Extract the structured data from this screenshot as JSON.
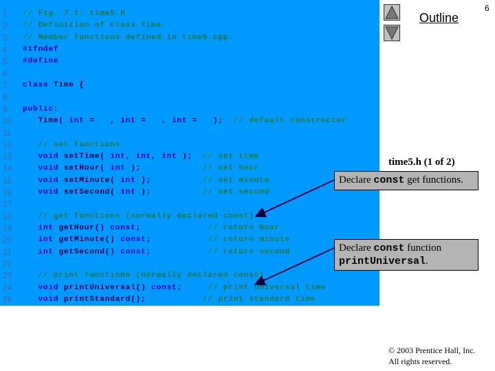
{
  "code_lines": [
    {
      "n": "1",
      "t": [
        [
          "c",
          "// Fig. 7.1: time5.h"
        ]
      ]
    },
    {
      "n": "2",
      "t": [
        [
          "c",
          "// Definition of class Time."
        ]
      ]
    },
    {
      "n": "3",
      "t": [
        [
          "c",
          "// Member functions defined in time5.cpp."
        ]
      ]
    },
    {
      "n": "4",
      "t": [
        [
          "p",
          "#ifndef"
        ]
      ]
    },
    {
      "n": "5",
      "t": [
        [
          "p",
          "#define"
        ]
      ]
    },
    {
      "n": "6",
      "t": []
    },
    {
      "n": "7",
      "t": [
        [
          "k",
          "class "
        ],
        [
          "i",
          "Time {"
        ]
      ]
    },
    {
      "n": "8",
      "t": []
    },
    {
      "n": "9",
      "t": [
        [
          "k",
          "public:"
        ]
      ]
    },
    {
      "n": "10",
      "t": [
        [
          "i",
          "   Time( "
        ],
        [
          "k",
          "int"
        ],
        [
          "i",
          " =   , "
        ],
        [
          "k",
          "int"
        ],
        [
          "i",
          " =   , "
        ],
        [
          "k",
          "int"
        ],
        [
          "i",
          " =   );  "
        ],
        [
          "c",
          "// default constructor"
        ]
      ]
    },
    {
      "n": "11",
      "t": []
    },
    {
      "n": "12",
      "t": [
        [
          "c",
          "   // set functions"
        ]
      ]
    },
    {
      "n": "13",
      "t": [
        [
          "k",
          "   void "
        ],
        [
          "i",
          "setTime( "
        ],
        [
          "k",
          "int"
        ],
        [
          "i",
          ", "
        ],
        [
          "k",
          "int"
        ],
        [
          "i",
          ", "
        ],
        [
          "k",
          "int"
        ],
        [
          "i",
          " );  "
        ],
        [
          "c",
          "// set time"
        ]
      ]
    },
    {
      "n": "14",
      "t": [
        [
          "k",
          "   void "
        ],
        [
          "i",
          "setHour( "
        ],
        [
          "k",
          "int"
        ],
        [
          "i",
          " );            "
        ],
        [
          "c",
          "// set hour"
        ]
      ]
    },
    {
      "n": "15",
      "t": [
        [
          "k",
          "   void "
        ],
        [
          "i",
          "setMinute( "
        ],
        [
          "k",
          "int"
        ],
        [
          "i",
          " );          "
        ],
        [
          "c",
          "// set minute"
        ]
      ]
    },
    {
      "n": "16",
      "t": [
        [
          "k",
          "   void "
        ],
        [
          "i",
          "setSecond( "
        ],
        [
          "k",
          "int"
        ],
        [
          "i",
          " );          "
        ],
        [
          "c",
          "// set second"
        ]
      ]
    },
    {
      "n": "17",
      "t": []
    },
    {
      "n": "18",
      "t": [
        [
          "c",
          "   // get functions (normally declared const)"
        ]
      ]
    },
    {
      "n": "19",
      "t": [
        [
          "k",
          "   int "
        ],
        [
          "i",
          "getHour() "
        ],
        [
          "k",
          "const"
        ],
        [
          "i",
          ";             "
        ],
        [
          "c",
          "// return hour"
        ]
      ]
    },
    {
      "n": "20",
      "t": [
        [
          "k",
          "   int "
        ],
        [
          "i",
          "getMinute() "
        ],
        [
          "k",
          "const"
        ],
        [
          "i",
          ";           "
        ],
        [
          "c",
          "// return minute"
        ]
      ]
    },
    {
      "n": "21",
      "t": [
        [
          "k",
          "   int "
        ],
        [
          "i",
          "getSecond() "
        ],
        [
          "k",
          "const"
        ],
        [
          "i",
          ";           "
        ],
        [
          "c",
          "// return second"
        ]
      ]
    },
    {
      "n": "22",
      "t": []
    },
    {
      "n": "23",
      "t": [
        [
          "c",
          "   // print functions (normally declared const)"
        ]
      ]
    },
    {
      "n": "24",
      "t": [
        [
          "k",
          "   void "
        ],
        [
          "i",
          "printUniversal() "
        ],
        [
          "k",
          "const"
        ],
        [
          "i",
          ";     "
        ],
        [
          "c",
          "// print universal time"
        ]
      ]
    },
    {
      "n": "25",
      "t": [
        [
          "k",
          "   void "
        ],
        [
          "i",
          "printStandard();           "
        ],
        [
          "c",
          "// print standard time"
        ]
      ]
    }
  ],
  "nav": {
    "up_icon": "triangle-up-icon",
    "down_icon": "triangle-down-icon",
    "outline_label": "Outline",
    "page_number": "6"
  },
  "file_label": "time5.h (1 of 2)",
  "callouts": [
    {
      "pre": "Declare ",
      "code": "const",
      "post": " get functions."
    },
    {
      "pre": "Declare ",
      "code": "const",
      "post": " function ",
      "code2": "printUniversal",
      "post2": "."
    }
  ],
  "footer": {
    "line1": "© 2003 Prentice Hall, Inc.",
    "line2": "All rights reserved."
  },
  "colors": {
    "code_bg": "#0099ff",
    "comment": "#007a3a",
    "keyword": "#0000cc",
    "callout_bg": "#b4b4b4"
  }
}
